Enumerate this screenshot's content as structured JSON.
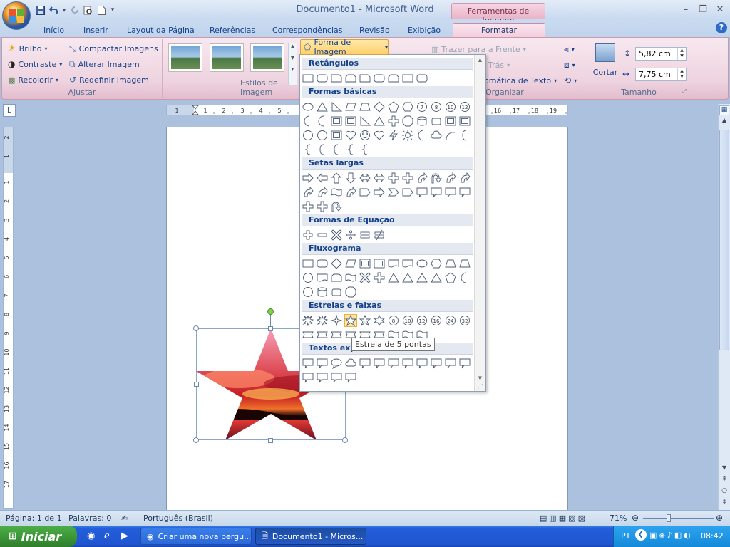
{
  "window": {
    "title": "Documento1 - Microsoft Word",
    "context_tab_group": "Ferramentas de Imagem",
    "controls": [
      "minimize",
      "restore",
      "close"
    ]
  },
  "tabs": [
    "Início",
    "Inserir",
    "Layout da Página",
    "Referências",
    "Correspondências",
    "Revisão",
    "Exibição",
    "Formatar"
  ],
  "active_tab": "Formatar",
  "ribbon": {
    "ajustar": {
      "label": "Ajustar",
      "brilho": "Brilho",
      "contraste": "Contraste",
      "recolorir": "Recolorir",
      "compactar": "Compactar Imagens",
      "alterar": "Alterar Imagem",
      "redefinir": "Redefinir Imagem"
    },
    "estilos": {
      "label": "Estilos de Imagem"
    },
    "forma_button": "Forma de Imagem",
    "organizar": {
      "label": "Organizar",
      "trazer": "Trazer para a Frente",
      "tras": "Trás",
      "quebra": "omática de Texto"
    },
    "tamanho": {
      "label": "Tamanho",
      "cortar": "Cortar",
      "height": "5,82 cm",
      "width": "7,75 cm"
    }
  },
  "gallery": {
    "categories": {
      "retangulos": "Retângulos",
      "basicas": "Formas básicas",
      "setas": "Setas largas",
      "equacao": "Formas de Equação",
      "fluxograma": "Fluxograma",
      "estrelas": "Estrelas e faixas",
      "textos": "Textos expli"
    },
    "tooltip": "Estrela de 5 pontas",
    "hovered_shape": "Estrela de 5 pontas"
  },
  "rulers": {
    "horizontal_numbers": [
      "1",
      "1",
      "2",
      "3",
      "4",
      "5",
      "16",
      "17",
      "18",
      "19"
    ],
    "vertical_numbers": [
      "2",
      "1",
      "1",
      "2",
      "3",
      "4",
      "5",
      "6",
      "7",
      "8",
      "9",
      "10",
      "11",
      "12",
      "13",
      "14",
      "15",
      "16",
      "17"
    ]
  },
  "statusbar": {
    "page": "Página: 1 de 1",
    "words": "Palavras: 0",
    "language": "Português (Brasil)",
    "zoom": "71%"
  },
  "taskbar": {
    "start": "Iniciar",
    "items": [
      "Criar uma nova pergu...",
      "Documento1 - Micros..."
    ],
    "lang": "PT",
    "time": "08:42"
  },
  "colors": {
    "ribbon_pink": "#f4cedc",
    "accent_blue": "#15428b",
    "taskbar_blue": "#245edb",
    "start_green": "#3c9838",
    "hover_gold": "#ffe6a0"
  }
}
